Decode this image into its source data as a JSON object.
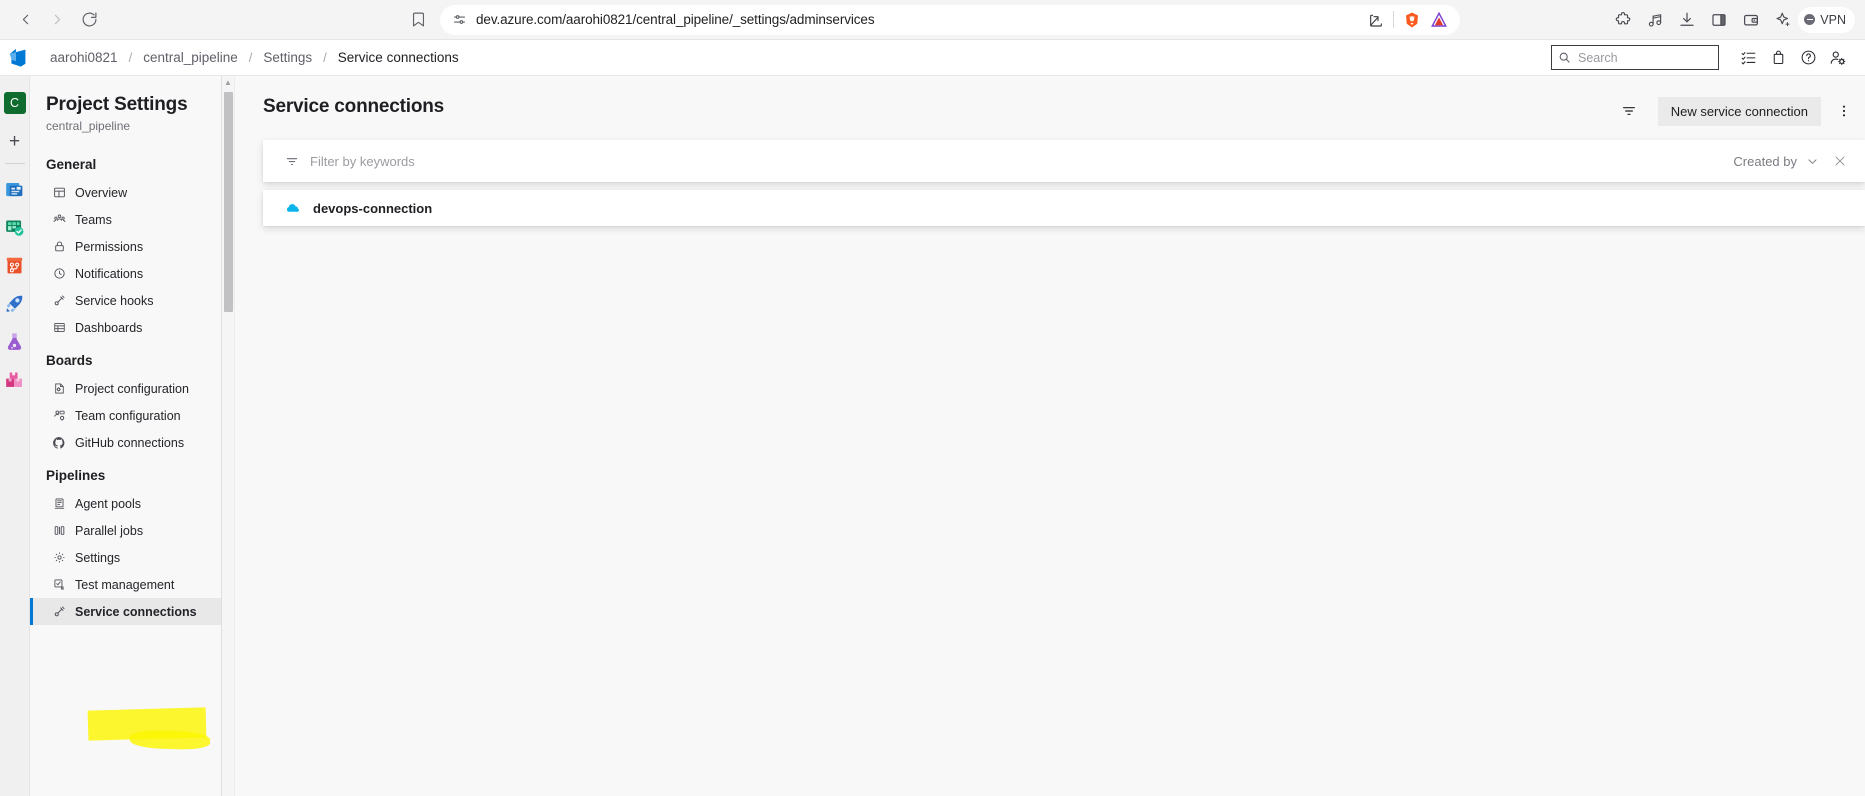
{
  "browser": {
    "back_label": "Back",
    "forward_label": "Forward",
    "reload_label": "Reload",
    "bookmark_label": "Bookmark this tab",
    "url": "dev.azure.com/aarohi0821/central_pipeline/_settings/adminservices",
    "site_settings_icon": "tune-icon",
    "share_icon": "share-icon",
    "brave_shields_icon": "brave-lion-icon",
    "extension_icon": "triangle-extension-icon",
    "toolbar_icons": [
      {
        "name": "puzzle-extensions-icon",
        "label": "Extensions"
      },
      {
        "name": "music-note-icon",
        "label": "Brave playlist"
      },
      {
        "name": "download-icon",
        "label": "Downloads"
      },
      {
        "name": "sidebar-panel-icon",
        "label": "Side panel"
      },
      {
        "name": "wallet-icon",
        "label": "Brave wallet"
      },
      {
        "name": "brave-leo-icon",
        "label": "Leo AI"
      }
    ],
    "vpn_label": "VPN"
  },
  "ado_header": {
    "logo_name": "azure-devops-logo",
    "breadcrumb": [
      {
        "label": "aarohi0821",
        "current": false
      },
      {
        "label": "central_pipeline",
        "current": false
      },
      {
        "label": "Settings",
        "current": false
      },
      {
        "label": "Service connections",
        "current": true
      }
    ],
    "separator": "/",
    "search_placeholder": "Search",
    "search_value": "",
    "icons": [
      {
        "name": "checklist-icon",
        "label": "My work items"
      },
      {
        "name": "shopping-bag-icon",
        "label": "Marketplace"
      },
      {
        "name": "help-circle-icon",
        "label": "Help"
      },
      {
        "name": "user-settings-icon",
        "label": "User settings"
      }
    ]
  },
  "rail": {
    "avatar_initial": "C",
    "add_label": "+",
    "items": [
      {
        "name": "rail-item-overview",
        "label": "Overview"
      },
      {
        "name": "rail-item-boards",
        "label": "Boards"
      },
      {
        "name": "rail-item-repos",
        "label": "Repos"
      },
      {
        "name": "rail-item-pipelines",
        "label": "Pipelines"
      },
      {
        "name": "rail-item-test-plans",
        "label": "Test Plans"
      },
      {
        "name": "rail-item-artifacts",
        "label": "Artifacts"
      }
    ]
  },
  "sidebar": {
    "title": "Project Settings",
    "subtitle": "central_pipeline",
    "groups": [
      {
        "header": "General",
        "items": [
          {
            "label": "Overview",
            "icon": "grid-icon",
            "selected": false
          },
          {
            "label": "Teams",
            "icon": "people-icon",
            "selected": false
          },
          {
            "label": "Permissions",
            "icon": "lock-icon",
            "selected": false
          },
          {
            "label": "Notifications",
            "icon": "bell-clock-icon",
            "selected": false
          },
          {
            "label": "Service hooks",
            "icon": "plug-icon",
            "selected": false
          },
          {
            "label": "Dashboards",
            "icon": "dashboard-icon",
            "selected": false
          }
        ]
      },
      {
        "header": "Boards",
        "items": [
          {
            "label": "Project configuration",
            "icon": "config-page-icon",
            "selected": false
          },
          {
            "label": "Team configuration",
            "icon": "team-config-icon",
            "selected": false
          },
          {
            "label": "GitHub connections",
            "icon": "github-icon",
            "selected": false
          }
        ]
      },
      {
        "header": "Pipelines",
        "items": [
          {
            "label": "Agent pools",
            "icon": "server-icon",
            "selected": false
          },
          {
            "label": "Parallel jobs",
            "icon": "columns-icon",
            "selected": false
          },
          {
            "label": "Settings",
            "icon": "gear-icon",
            "selected": false
          },
          {
            "label": "Test management",
            "icon": "test-check-icon",
            "selected": false
          },
          {
            "label": "Service connections",
            "icon": "plug-icon",
            "selected": true
          }
        ]
      }
    ]
  },
  "main": {
    "title": "Service connections",
    "filter_toggle_icon": "filter-icon",
    "new_connection_label": "New service connection",
    "more_actions_icon": "more-vertical-icon",
    "filter": {
      "icon": "filter-lines-icon",
      "placeholder": "Filter by keywords",
      "value": "",
      "created_by_label": "Created by",
      "chevron_icon": "chevron-down-icon",
      "clear_icon": "close-icon"
    },
    "connections": [
      {
        "name": "devops-connection",
        "icon": "azure-cloud-icon",
        "icon_color": "#0bb3ec"
      }
    ]
  },
  "colors": {
    "accent": "#0078d4",
    "highlight": "#fbf500",
    "avatar_bg": "#0f6b2e",
    "cloud_blue": "#0bb3ec"
  }
}
